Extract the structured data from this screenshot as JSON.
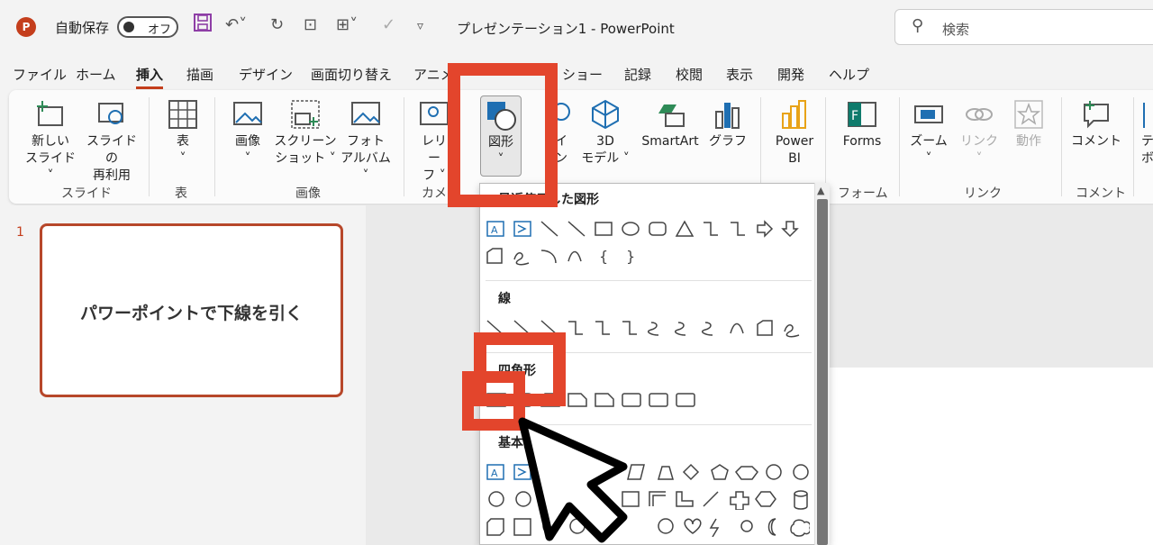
{
  "titlebar": {
    "autosave_label": "自動保存",
    "toggle_label": "オフ",
    "doc_title": "プレゼンテーション1  -  PowerPoint",
    "search_placeholder": "検索"
  },
  "tabs": [
    "ファイル",
    "ホーム",
    "挿入",
    "描画",
    "デザイン",
    "画面切り替え",
    "アニメ",
    "ショー",
    "記録",
    "校閲",
    "表示",
    "開発",
    "ヘルプ"
  ],
  "active_tab": "挿入",
  "ribbon": {
    "new_slide": [
      "新しい",
      "スライド ˅"
    ],
    "reuse_slide": [
      "スライドの",
      "再利用"
    ],
    "table": [
      "表",
      "˅"
    ],
    "picture": [
      "画像",
      "˅"
    ],
    "screenshot": [
      "スクリーン",
      "ショット ˅"
    ],
    "photo_album": [
      "フォト",
      "アルバム ˅"
    ],
    "cameo": [
      "レリー",
      "フ ˅"
    ],
    "shapes": [
      "図形",
      "˅"
    ],
    "icons": [
      "イ",
      "ン"
    ],
    "model3d": [
      "3D",
      "モデル ˅"
    ],
    "smartart": "SmartArt",
    "chart": "グラフ",
    "powerbi": [
      "Power",
      "BI"
    ],
    "forms": "Forms",
    "zoom": [
      "ズーム",
      "˅"
    ],
    "link": [
      "リンク",
      "˅"
    ],
    "action": "動作",
    "comment": "コメント",
    "textbox": [
      "テ",
      "ボ"
    ],
    "groups": {
      "slides": "スライド",
      "tables": "表",
      "images": "画像",
      "camera": "カメラ",
      "forms": "フォーム",
      "links": "リンク",
      "comments": "コメント"
    }
  },
  "slide_thumb": {
    "number": "1",
    "text": "パワーポイントで下線を引く"
  },
  "shapes_menu": {
    "recent": "最近使用した図形",
    "lines": "線",
    "rectangles": "四角形",
    "basic": "基本図形"
  },
  "colors": {
    "accent": "#c43e1c",
    "highlight": "#e3452c"
  }
}
